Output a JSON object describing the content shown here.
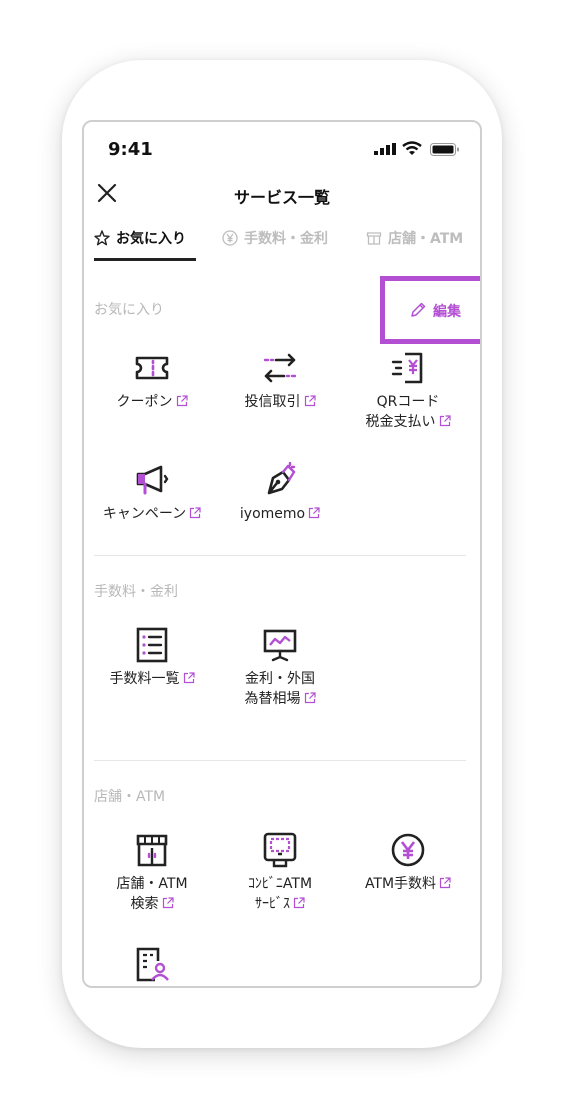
{
  "status_bar": {
    "time": "9:41"
  },
  "header": {
    "title": "サービス一覧"
  },
  "tabs": [
    {
      "label": "お気に入り",
      "active": true
    },
    {
      "label": "手数料・金利",
      "active": false
    },
    {
      "label": "店舗・ATM",
      "active": false
    }
  ],
  "favorites": {
    "title": "お気に入り",
    "edit_label": "編集",
    "items": [
      {
        "label": "クーポン",
        "icon": "coupon-icon"
      },
      {
        "label": "投信取引",
        "icon": "exchange-arrows-icon"
      },
      {
        "label_line1": "QRコード",
        "label_line2": "税金支払い",
        "icon": "qr-tax-payment-icon"
      },
      {
        "label": "キャンペーン",
        "icon": "megaphone-icon"
      },
      {
        "label": "iyomemo",
        "icon": "pen-nib-icon"
      }
    ]
  },
  "fees": {
    "title": "手数料・金利",
    "items": [
      {
        "label": "手数料一覧",
        "icon": "list-document-icon"
      },
      {
        "label_line1": "金利・外国",
        "label_line2": "為替相場",
        "icon": "chart-board-icon"
      }
    ]
  },
  "stores": {
    "title": "店舗・ATM",
    "items": [
      {
        "label_line1": "店舗・ATM",
        "label_line2": "検索",
        "icon": "store-icon"
      },
      {
        "label_line1": "ｺﾝﾋﾞﾆATM",
        "label_line2": "ｻｰﾋﾞｽ",
        "icon": "atm-machine-icon"
      },
      {
        "label": "ATM手数料",
        "icon": "yen-circle-icon"
      },
      {
        "icon": "building-person-icon"
      }
    ]
  },
  "colors": {
    "accent": "#b24fd3",
    "text": "#222222",
    "muted": "#bdbdbd"
  }
}
